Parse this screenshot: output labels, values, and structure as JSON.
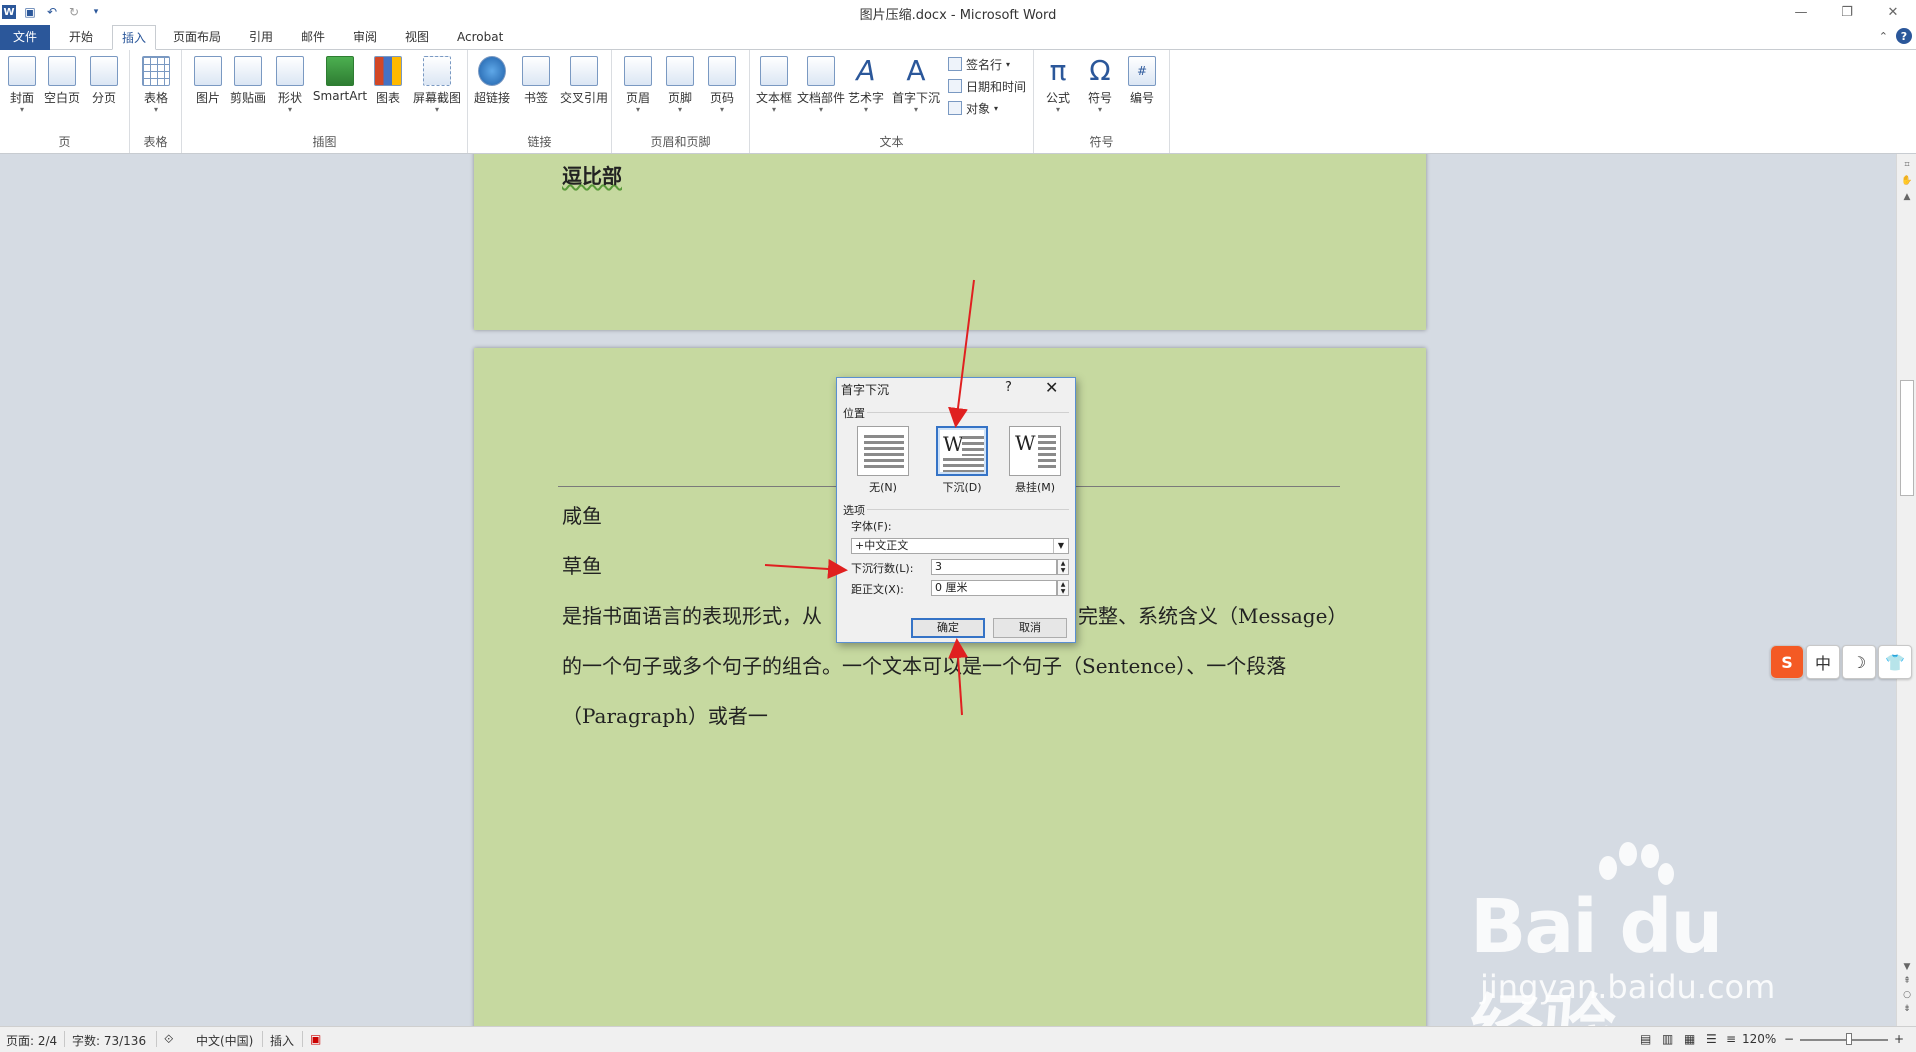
{
  "window": {
    "title": "图片压缩.docx - Microsoft Word",
    "app_icon": "W"
  },
  "quick_access": {
    "icons": [
      "word-logo-icon",
      "save-icon",
      "undo-icon",
      "redo-icon",
      "customize-icon"
    ]
  },
  "tabs": [
    {
      "label": "文件",
      "active": false
    },
    {
      "label": "开始",
      "active": false
    },
    {
      "label": "插入",
      "active": true
    },
    {
      "label": "页面布局",
      "active": false
    },
    {
      "label": "引用",
      "active": false
    },
    {
      "label": "邮件",
      "active": false
    },
    {
      "label": "审阅",
      "active": false
    },
    {
      "label": "视图",
      "active": false
    },
    {
      "label": "Acrobat",
      "active": false
    }
  ],
  "ribbon": {
    "groups": {
      "page": {
        "label": "页",
        "buttons": [
          "封面",
          "空白页",
          "分页"
        ]
      },
      "table": {
        "label": "表格",
        "buttons": [
          "表格"
        ]
      },
      "illustrations": {
        "label": "插图",
        "buttons": [
          "图片",
          "剪贴画",
          "形状",
          "SmartArt",
          "图表",
          "屏幕截图"
        ]
      },
      "links": {
        "label": "链接",
        "buttons": [
          "超链接",
          "书签",
          "交叉引用"
        ]
      },
      "header_footer": {
        "label": "页眉和页脚",
        "buttons": [
          "页眉",
          "页脚",
          "页码"
        ]
      },
      "text": {
        "label": "文本",
        "buttons": [
          "文本框",
          "文档部件",
          "艺术字",
          "首字下沉"
        ],
        "small_buttons": [
          "签名行",
          "日期和时间",
          "对象"
        ]
      },
      "symbols": {
        "label": "符号",
        "buttons": [
          "公式",
          "符号",
          "编号"
        ],
        "glyphs": [
          "π",
          "Ω",
          "#"
        ]
      }
    }
  },
  "document": {
    "page1_text": "逗比部",
    "line1": "咸鱼",
    "line2": "草鱼",
    "para_line1_left": "是指书面语言的表现形式，从",
    "para_line1_right": "完整、系统含义（Message）",
    "para_line2": "的一个句子或多个句子的组合。一个文本可以是一个句子（Sentence）、一个段落",
    "para_line3": "（Paragraph）或者一"
  },
  "dialog": {
    "title": "首字下沉",
    "help": "?",
    "close": "✕",
    "position_label": "位置",
    "options": [
      {
        "label": "无(N)",
        "selected": false
      },
      {
        "label": "下沉(D)",
        "selected": true
      },
      {
        "label": "悬挂(M)",
        "selected": false
      }
    ],
    "options_label": "选项",
    "font_label": "字体(F):",
    "font_value": "+中文正文",
    "lines_label": "下沉行数(L):",
    "lines_value": "3",
    "distance_label": "距正文(X):",
    "distance_value": "0 厘米",
    "ok": "确定",
    "cancel": "取消"
  },
  "ime": {
    "items": [
      "S",
      "中",
      "☽",
      "👕"
    ]
  },
  "watermark": {
    "brand": "Bai du 经验",
    "url": "jingyan.baidu.com"
  },
  "statusbar": {
    "page": "页面: 2/4",
    "words": "字数: 73/136",
    "language": "中文(中国)",
    "mode": "插入",
    "zoom": "120%",
    "zoom_minus": "−",
    "zoom_plus": "+"
  },
  "colors": {
    "page_background": "#c6d9a0",
    "accent": "#2b579a",
    "annotation_arrow": "#e02020"
  }
}
